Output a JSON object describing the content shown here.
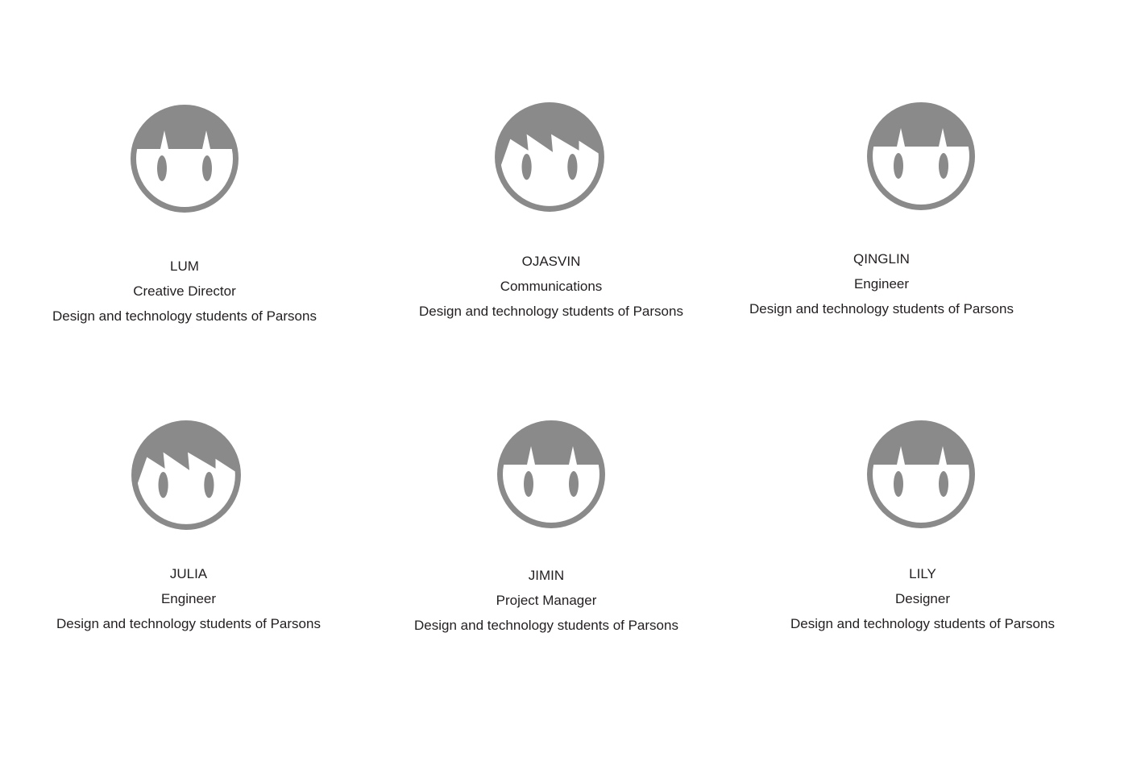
{
  "colors": {
    "avatar": "#8a8a8a",
    "text": "#231f20",
    "background": "#ffffff"
  },
  "members": [
    {
      "name": "LUM",
      "role": "Creative Director",
      "description": "Design and technology students of Parsons",
      "hair": "bob-icon"
    },
    {
      "name": "OJASVIN",
      "role": "Communications",
      "description": "Design and technology students of Parsons",
      "hair": "spiky-icon"
    },
    {
      "name": "QINGLIN",
      "role": "Engineer",
      "description": "Design and technology students of Parsons",
      "hair": "bob-icon"
    },
    {
      "name": "JULIA",
      "role": "Engineer",
      "description": "Design and technology students of Parsons",
      "hair": "spiky-icon"
    },
    {
      "name": "JIMIN",
      "role": "Project Manager",
      "description": "Design and technology students of Parsons",
      "hair": "bob-icon"
    },
    {
      "name": "LILY",
      "role": "Designer",
      "description": "Design and technology students of Parsons",
      "hair": "bob-icon"
    }
  ]
}
